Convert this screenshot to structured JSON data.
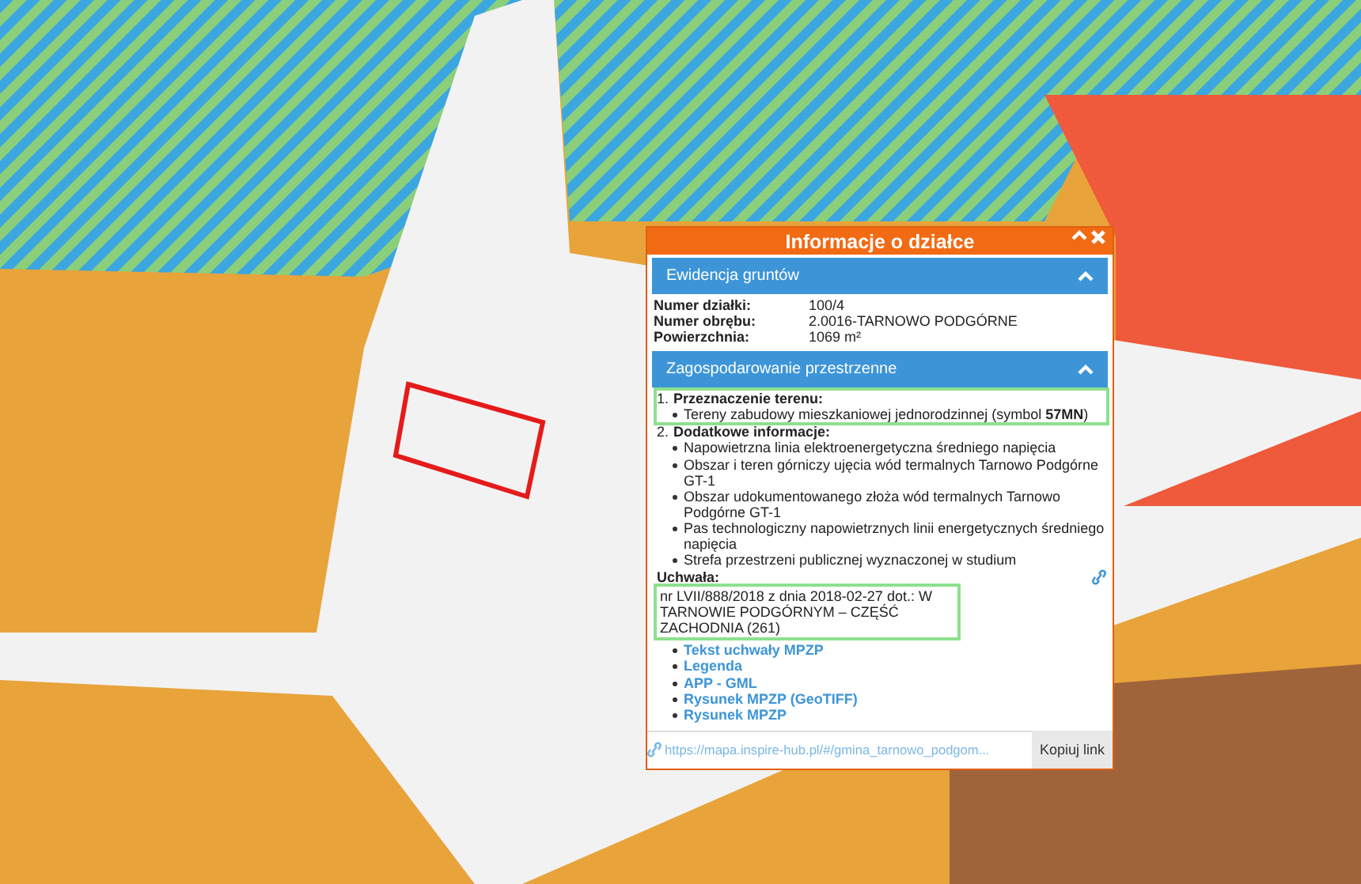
{
  "popup": {
    "title": "Informacje o działce",
    "land_registry": {
      "title": "Ewidencja gruntów",
      "expanded": true,
      "fields": [
        {
          "label": "Numer działki:",
          "value": "100/4"
        },
        {
          "label": "Numer obrębu:",
          "value": "2.0016-TARNOWO PODGÓRNE"
        },
        {
          "label": "Powierzchnia:",
          "value": "1069 m²"
        }
      ]
    },
    "planning": {
      "title": "Zagospodarowanie przestrzenne",
      "expanded": true,
      "items": [
        {
          "number": "1.",
          "heading": "Przeznaczenie terenu:",
          "highlighted": true,
          "bullets": [
            "Tereny zabudowy mieszkaniowej jednorodzinnej (symbol **57MN**)"
          ]
        },
        {
          "number": "2.",
          "heading": "Dodatkowe informacje:",
          "highlighted": false,
          "bullets": [
            "Napowietrzna linia elektroenergetyczna średniego napięcia",
            "Obszar i teren górniczy ujęcia wód termalnych Tarnowo Podgórne GT-1",
            "Obszar udokumentowanego złoża wód termalnych Tarnowo Podgórne GT-1",
            "Pas technologiczny napowietrznych linii energetycznych średniego napięcia",
            "Strefa przestrzeni publicznej wyznaczonej w studium"
          ]
        }
      ],
      "resolution": {
        "label": "Uchwała:",
        "text": "nr LVII/888/2018 z dnia 2018-02-27 dot.: W TARNOWIE PODGÓRNYM – CZĘŚĆ ZACHODNIA (261)",
        "highlighted": true
      },
      "links": [
        "Tekst uchwały MPZP",
        "Legenda",
        "APP - GML",
        "Rysunek MPZP (GeoTIFF)",
        "Rysunek MPZP"
      ]
    },
    "footer": {
      "url": "https://mapa.inspire-hub.pl/#/gmina_tarnowo_podgom...",
      "button": "Kopiuj link"
    }
  }
}
